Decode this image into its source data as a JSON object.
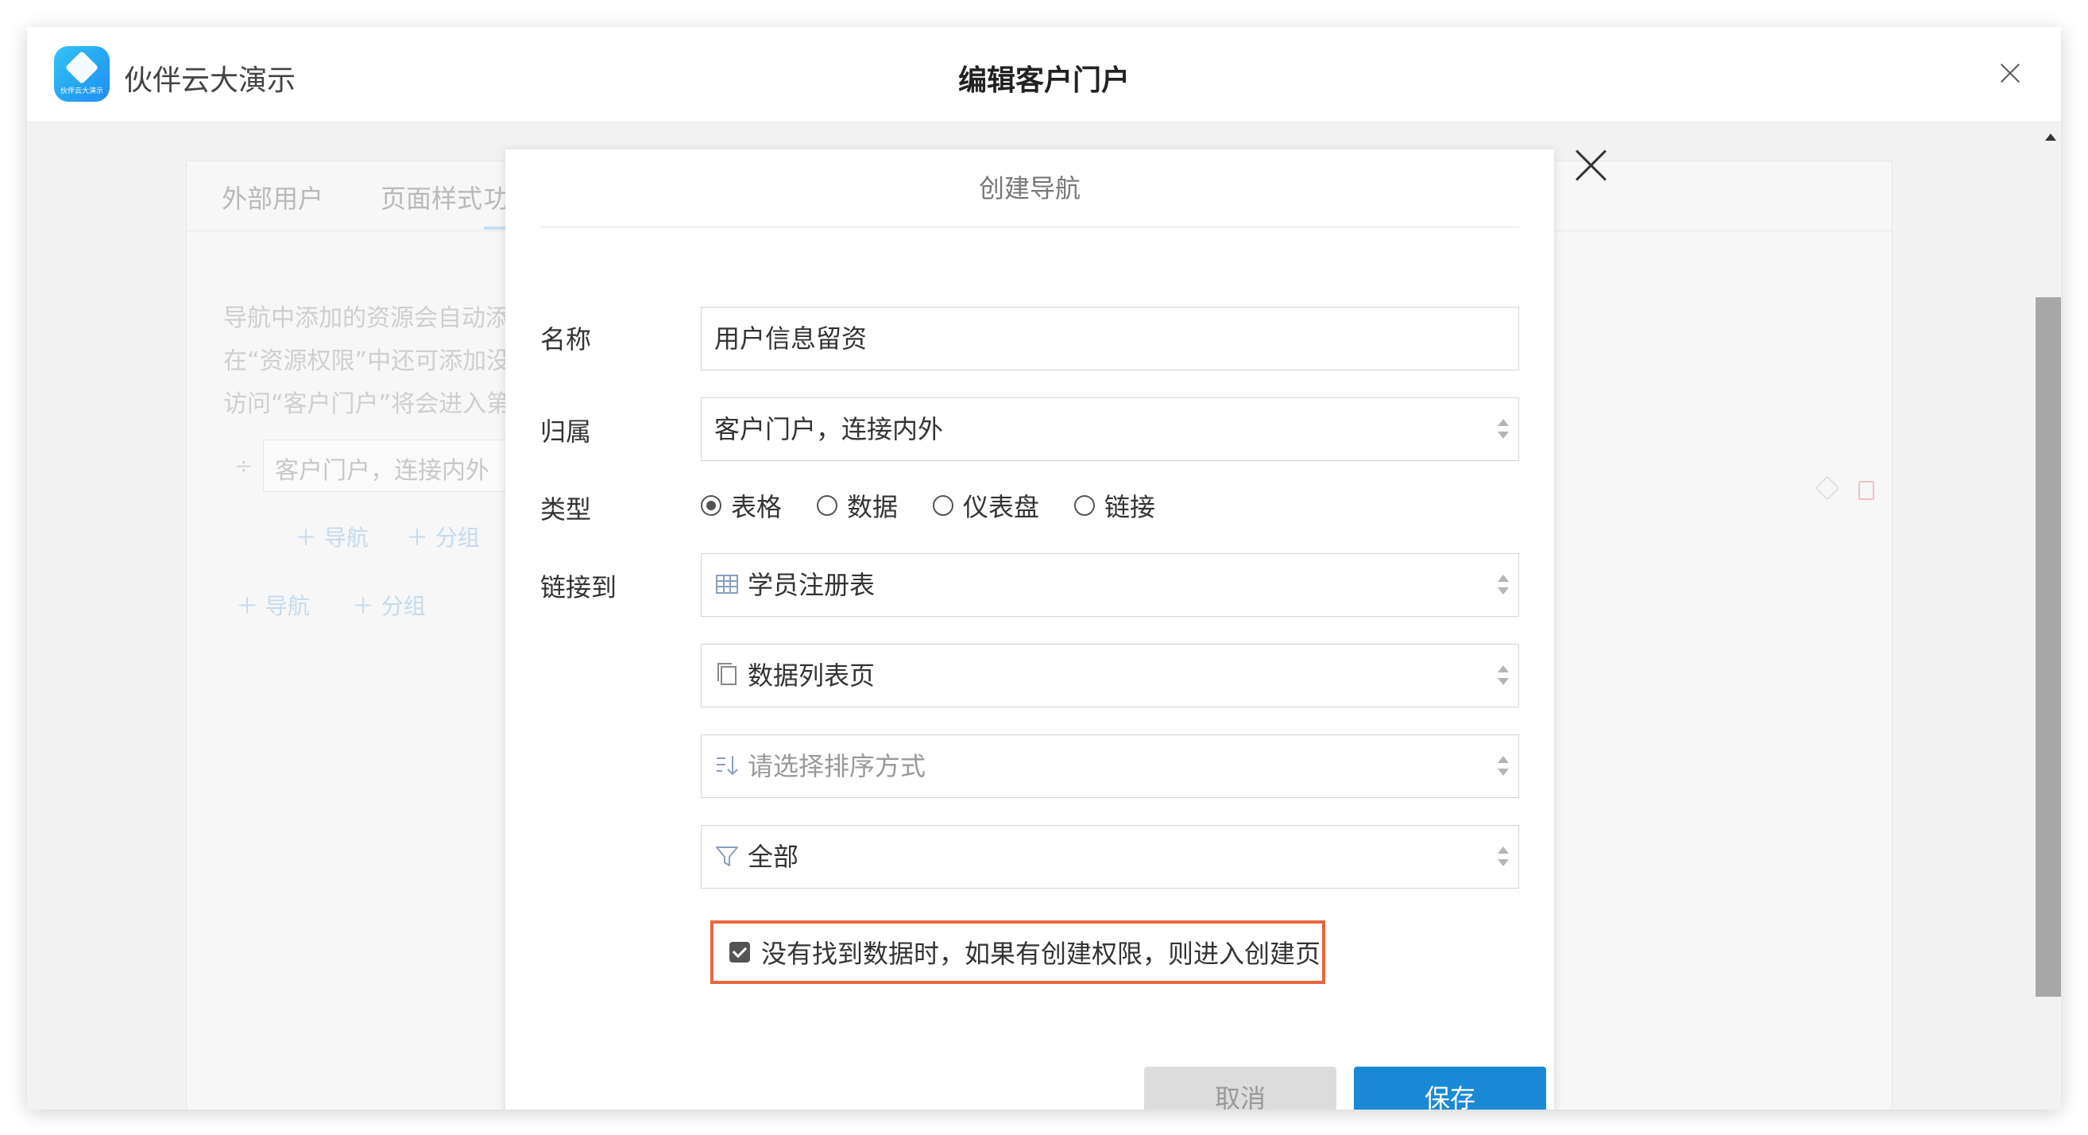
{
  "app": {
    "name": "伙伴云大演示",
    "logo_text": "伙伴云大演示"
  },
  "window": {
    "title": "编辑客户门户"
  },
  "background": {
    "tabs": [
      "外部用户",
      "页面样式",
      "功"
    ],
    "description_lines": [
      "导航中添加的资源会自动添",
      "在“资源权限”中还可添加没",
      "访问“客户门户”将会进入第"
    ],
    "nav_item_value": "客户门户，连接内外",
    "add_nav_label": "＋ 导航",
    "add_group_label": "＋ 分组"
  },
  "modal": {
    "title": "创建导航",
    "name": {
      "label": "名称",
      "value": "用户信息留资"
    },
    "belongs": {
      "label": "归属",
      "value": "客户门户，连接内外"
    },
    "type": {
      "label": "类型",
      "options": [
        "表格",
        "数据",
        "仪表盘",
        "链接"
      ],
      "selected": "表格"
    },
    "link_to": {
      "label": "链接到",
      "table": {
        "value": "学员注册表",
        "icon": "table-icon"
      },
      "page": {
        "value": "数据列表页",
        "icon": "page-copy-icon"
      },
      "sort": {
        "placeholder": "请选择排序方式",
        "icon": "sort-icon"
      },
      "filter": {
        "value": "全部",
        "icon": "filter-icon"
      }
    },
    "checkbox": {
      "label": "没有找到数据时，如果有创建权限，则进入创建页",
      "checked": true
    },
    "cancel_label": "取消",
    "save_label": "保存"
  },
  "colors": {
    "primary": "#1a8ad6",
    "highlight_border": "#e8673c",
    "cancel_bg": "#dcdcdc"
  }
}
